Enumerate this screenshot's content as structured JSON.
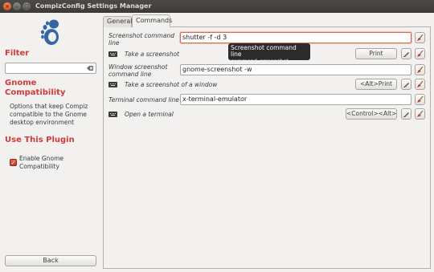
{
  "window": {
    "title": "CompizConfig Settings Manager"
  },
  "sidebar": {
    "filter_heading": "Filter",
    "filter_value": "",
    "plugin_name": "Gnome Compatibility",
    "plugin_description": "Options that keep Compiz compatible to the Gnome desktop environment",
    "use_plugin_heading": "Use This Plugin",
    "enable_label": "Enable Gnome Compatibility",
    "enable_checked": true,
    "back_label": "Back"
  },
  "tabs": [
    {
      "label": "General",
      "active": false
    },
    {
      "label": "Commands",
      "active": true
    }
  ],
  "settings": {
    "screenshot_cmd_label": "Screenshot command line",
    "screenshot_cmd_value": "shutter -f -d 3",
    "take_screenshot_label": "Take a screenshot",
    "take_screenshot_key": "Print",
    "window_screenshot_cmd_label": "Window screenshot command line",
    "window_screenshot_cmd_value": "gnome-screenshot -w",
    "take_window_screenshot_label": "Take a screenshot of a window",
    "take_window_screenshot_key": "<Alt>Print",
    "terminal_cmd_label": "Terminal command line",
    "terminal_cmd_value": "x-terminal-emulator",
    "open_terminal_label": "Open a terminal",
    "open_terminal_key": "<Control><Alt>t"
  },
  "tooltip": {
    "title": "Screenshot command line",
    "subtitle": "command_screenshot"
  },
  "icons": {
    "logo": "gnome-foot-icon",
    "reset": "broom-reset-icon",
    "edit": "pencil-edit-icon",
    "keyboard": "keyboard-icon",
    "clear": "clear-icon"
  },
  "colors": {
    "accent": "#d23a3a",
    "titlebar": "#3c3b37",
    "focus": "#e06a4a"
  }
}
